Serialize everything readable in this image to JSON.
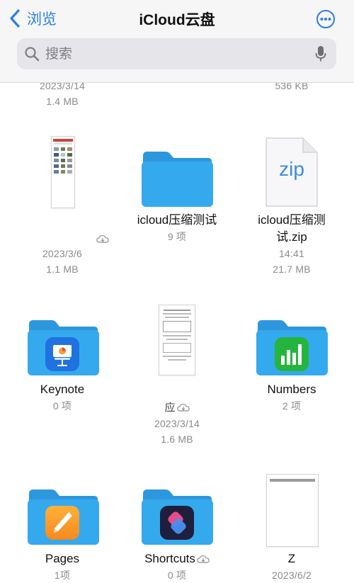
{
  "header": {
    "back_label": "浏览",
    "title": "iCloud云盘",
    "search_placeholder": "搜索"
  },
  "colors": {
    "accent": "#2a7de9",
    "folder": "#35a9ee",
    "folder_tab": "#2d97dd"
  },
  "items_top_partial": [
    {
      "date": "2023/3/14",
      "size": "1.4 MB"
    },
    {
      "size": "536 KB"
    }
  ],
  "row1": [
    {
      "type": "document-thumbnail",
      "cloud": true,
      "date": "2023/3/6",
      "size": "1.1 MB",
      "icon": "webpage-thumbnail"
    },
    {
      "type": "folder",
      "name": "icloud压缩测试",
      "count": "9 项",
      "icon": "folder-icon"
    },
    {
      "type": "zip",
      "name_line1": "icloud压缩测",
      "name_line2": "试.zip",
      "time": "14:41",
      "size": "21.7 MB",
      "icon_label": "zip"
    }
  ],
  "row2": [
    {
      "type": "app-folder",
      "name": "Keynote",
      "count": "0 项",
      "icon": "keynote-icon"
    },
    {
      "type": "document-thumbnail",
      "name_fragment": "应",
      "cloud": true,
      "date": "2023/3/14",
      "size": "1.6 MB",
      "icon": "document-thumbnail"
    },
    {
      "type": "app-folder",
      "name": "Numbers",
      "count": "2 项",
      "icon": "numbers-icon"
    }
  ],
  "row3": [
    {
      "type": "app-folder",
      "name": "Pages",
      "count": "1项",
      "icon": "pages-icon"
    },
    {
      "type": "app-folder",
      "name": "Shortcuts",
      "cloud": true,
      "count": "0 项",
      "icon": "shortcuts-icon"
    },
    {
      "type": "document-thumbnail",
      "name": "Z",
      "date": "2023/6/2",
      "icon": "blank-document-thumbnail"
    }
  ]
}
